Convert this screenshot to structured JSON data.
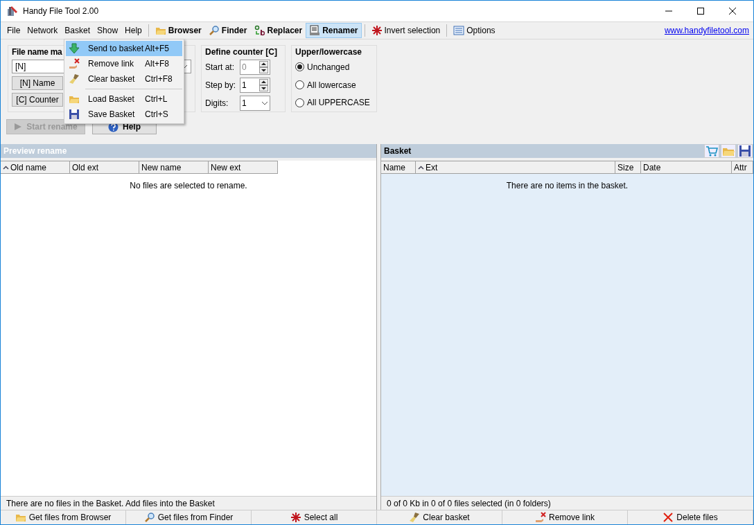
{
  "window": {
    "title": "Handy File Tool 2.00"
  },
  "menubar": [
    {
      "label": "File"
    },
    {
      "label": "Network"
    },
    {
      "label": "Basket"
    },
    {
      "label": "Show"
    },
    {
      "label": "Help"
    }
  ],
  "toolbar": [
    {
      "label": "Browser",
      "selected": false
    },
    {
      "label": "Finder",
      "selected": false
    },
    {
      "label": "Replacer",
      "selected": false
    },
    {
      "label": "Renamer",
      "selected": true
    },
    {
      "label": "Invert selection",
      "selected": false
    },
    {
      "label": "Options",
      "selected": false
    }
  ],
  "website_link": "www.handyfiletool.com",
  "basket_menu": [
    {
      "label": "Send to basket",
      "shortcut": "Alt+F5",
      "selected": true
    },
    {
      "label": "Remove link",
      "shortcut": "Alt+F8",
      "selected": false
    },
    {
      "label": "Clear basket",
      "shortcut": "Ctrl+F8",
      "selected": false
    },
    {
      "label": "Load Basket",
      "shortcut": "Ctrl+L",
      "selected": false
    },
    {
      "label": "Save Basket",
      "shortcut": "Ctrl+S",
      "selected": false
    }
  ],
  "file_name_mask": {
    "title": "File name ma",
    "value": "[N]",
    "buttons": [
      "[N] Name",
      "[C] Counter"
    ]
  },
  "define_counter": {
    "title": "Define counter [C]",
    "start_label": "Start at:",
    "start_value": "0",
    "step_label": "Step by:",
    "step_value": "1",
    "digits_label": "Digits:",
    "digits_value": "1"
  },
  "case_options": {
    "title": "Upper/lowercase",
    "options": [
      {
        "label": "Unchanged",
        "selected": true
      },
      {
        "label": "All lowercase",
        "selected": false
      },
      {
        "label": "All UPPERCASE",
        "selected": false
      }
    ]
  },
  "start_rename": {
    "label": "Start rename",
    "disabled": true
  },
  "help_button": {
    "label": "Help"
  },
  "preview_pane": {
    "title": "Preview rename",
    "columns": [
      {
        "label": "Old name",
        "sorted": true
      },
      {
        "label": "Old ext",
        "sorted": false
      },
      {
        "label": "New name",
        "sorted": false
      },
      {
        "label": "New ext",
        "sorted": false
      }
    ],
    "empty_message": "No files are selected to rename.",
    "status": "There are no files in the Basket. Add files into the Basket"
  },
  "basket_pane": {
    "title": "Basket",
    "columns": [
      {
        "label": "Name",
        "sorted": false
      },
      {
        "label": "Ext",
        "sorted": true
      },
      {
        "label": "Size",
        "sorted": false
      },
      {
        "label": "Date",
        "sorted": false
      },
      {
        "label": "Attr",
        "sorted": false
      }
    ],
    "empty_message": "There are no items in the basket.",
    "status": "0 of 0 Kb in 0 of 0 files selected (in 0 folders)"
  },
  "bottom_buttons": [
    {
      "label": "Get files from Browser"
    },
    {
      "label": "Get files from Finder"
    },
    {
      "label": "Select all"
    },
    {
      "label": "Clear basket"
    },
    {
      "label": "Remove link"
    },
    {
      "label": "Delete files"
    }
  ]
}
